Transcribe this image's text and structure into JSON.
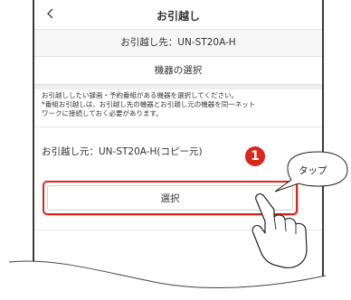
{
  "header": {
    "title": "お引越し",
    "back_icon": "chevron-left-icon"
  },
  "destination": {
    "text": "お引越し先：UN-ST20A-H"
  },
  "section": {
    "title": "機器の選択"
  },
  "instruction": {
    "lines": [
      "お引越ししたい録画・予約番組がある機器を選択してください。",
      "*番組お引越しは、お引越し先の機器とお引越し元の機器を同一ネット",
      "ワークに接続しておく必要があります。"
    ]
  },
  "source": {
    "text": "お引越し元：UN-ST20A-H(コピー元)"
  },
  "select_button": {
    "label": "選択"
  },
  "callout": {
    "step_number": "1",
    "tap_label": "タップ",
    "accent_color": "#d9271d"
  }
}
